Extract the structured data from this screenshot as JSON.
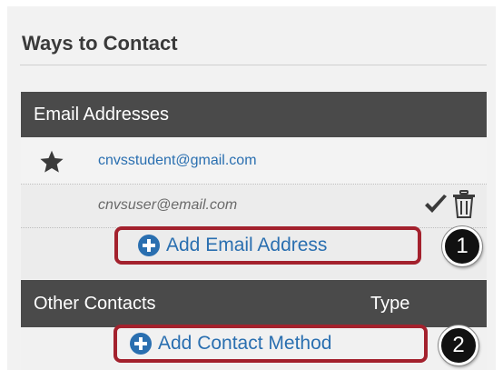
{
  "panel": {
    "title": "Ways to Contact"
  },
  "email_section": {
    "header": "Email Addresses",
    "primary_email": "cnvsstudent@gmail.com",
    "secondary_email": "cnvsuser@email.com",
    "add_label": "Add Email Address"
  },
  "other_section": {
    "header": "Other Contacts",
    "type_header": "Type",
    "add_label": "Add Contact Method"
  },
  "callouts": {
    "one": "1",
    "two": "2"
  },
  "colors": {
    "accent": "#2a6fb0",
    "header_bg": "#4a4a4a",
    "highlight": "#a3212d"
  },
  "icons": {
    "default": "star-icon",
    "confirm": "checkmark-icon",
    "delete": "trash-icon",
    "add": "plus-circle-icon"
  }
}
